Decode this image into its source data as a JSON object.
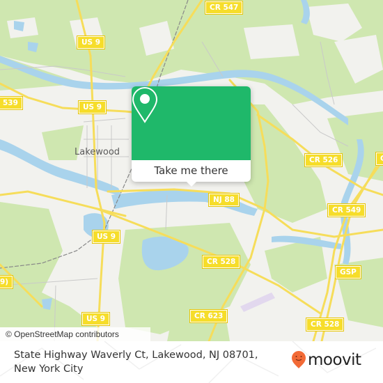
{
  "map": {
    "place_labels": [
      {
        "id": "lakewood",
        "text": "Lakewood"
      }
    ],
    "road_shields": [
      {
        "id": "cr547",
        "text": "CR 547"
      },
      {
        "id": "us9-top",
        "text": "US 9"
      },
      {
        "id": "cr539",
        "text": "539"
      },
      {
        "id": "us9-mid",
        "text": "US 9"
      },
      {
        "id": "cr526",
        "text": "CR 526"
      },
      {
        "id": "nj88",
        "text": "NJ 88"
      },
      {
        "id": "cr549",
        "text": "CR 549"
      },
      {
        "id": "us9-lower",
        "text": "US 9"
      },
      {
        "id": "cr528-mid",
        "text": "CR 528"
      },
      {
        "id": "gsp",
        "text": "GSP"
      },
      {
        "id": "cr623",
        "text": "CR 623"
      },
      {
        "id": "cr528-right",
        "text": "CR 528"
      },
      {
        "id": "us9-bottom",
        "text": "US 9"
      },
      {
        "id": "left-edge",
        "text": "9)"
      },
      {
        "id": "right-edge",
        "text": "C"
      }
    ],
    "attribution": "© OpenStreetMap contributors",
    "colors": {
      "land": "#f2f2ee",
      "forest": "#cfe7b0",
      "water": "#a9d3ec",
      "road": "#f6dd5a",
      "shield": "#f6dd2a"
    }
  },
  "popup": {
    "icon": "map-pin-icon",
    "button_label": "Take me there",
    "accent_color": "#1fb86a"
  },
  "footer": {
    "address_line1": "State Highway Waverly Ct, Lakewood, NJ 08701,",
    "address_line2": "New York City",
    "logo_text": "moovit",
    "logo_color": "#f26a36"
  }
}
